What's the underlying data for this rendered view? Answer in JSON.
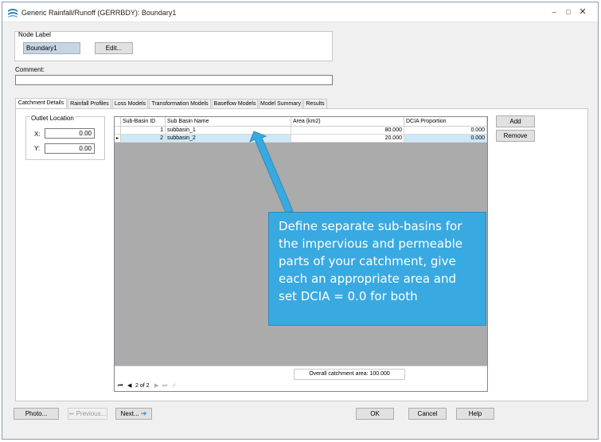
{
  "window": {
    "title": "Generic Rainfall/Runoff (GERRBDY): Boundary1",
    "minimize": "–",
    "maximize": "□",
    "close": "✕"
  },
  "node_label": {
    "group_label": "Node Label",
    "value": "Boundary1",
    "edit_button": "Edit..."
  },
  "comment": {
    "label": "Comment:",
    "value": ""
  },
  "tabs": [
    {
      "label": "Catchment Details",
      "active": true
    },
    {
      "label": "Rainfall Profiles",
      "active": false
    },
    {
      "label": "Loss Models",
      "active": false
    },
    {
      "label": "Transformation Models",
      "active": false
    },
    {
      "label": "Baseflow Models",
      "active": false
    },
    {
      "label": "Model Summary",
      "active": false
    },
    {
      "label": "Results",
      "active": false
    }
  ],
  "outlet": {
    "group_label": "Outlet Location",
    "x_label": "X:",
    "x_value": "0.00",
    "y_label": "Y:",
    "y_value": "0.00"
  },
  "grid": {
    "columns": [
      "Sub-Basin ID",
      "Sub Basin Name",
      "Area (km2)",
      "DCIA Proportion"
    ],
    "rows": [
      {
        "id": "1",
        "name": "subbasin_1",
        "area": "80.000",
        "dcia": "0.000",
        "selected": false
      },
      {
        "id": "2",
        "name": "subbasin_2",
        "area": "20.000",
        "dcia": "0.000",
        "selected": true
      }
    ],
    "total_label": "Overall catchment area: 100.000",
    "nav": {
      "first": "⏮",
      "prev": "◀",
      "position": "2 of 2",
      "next": "▶",
      "last": "⏭",
      "confirm": "✓"
    }
  },
  "side_buttons": {
    "add": "Add",
    "remove": "Remove"
  },
  "callout": {
    "lines": [
      "Define separate sub-basins for",
      "the impervious and permeable",
      "parts of your catchment, give",
      "each an appropriate area and",
      "set DCIA = 0.0 for both"
    ],
    "color": "#39a9e1"
  },
  "bottom": {
    "photo": "Photo...",
    "previous": "Previous...",
    "next": "Next...",
    "ok": "OK",
    "cancel": "Cancel",
    "help": "Help"
  }
}
